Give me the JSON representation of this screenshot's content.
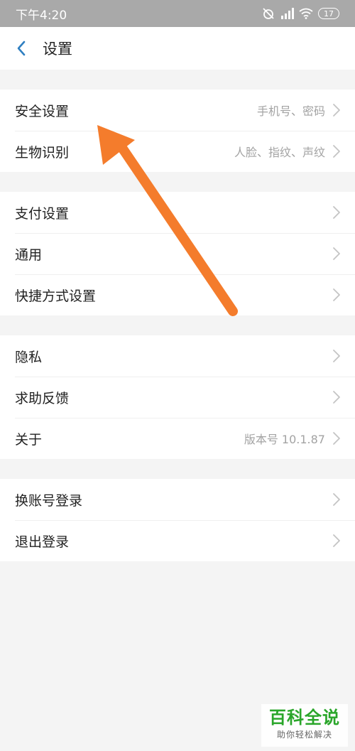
{
  "status_bar": {
    "time": "下午4:20",
    "battery": "17"
  },
  "header": {
    "title": "设置"
  },
  "groups": [
    [
      {
        "label": "安全设置",
        "value": "手机号、密码"
      },
      {
        "label": "生物识别",
        "value": "人脸、指纹、声纹"
      }
    ],
    [
      {
        "label": "支付设置",
        "value": ""
      },
      {
        "label": "通用",
        "value": ""
      },
      {
        "label": "快捷方式设置",
        "value": ""
      }
    ],
    [
      {
        "label": "隐私",
        "value": ""
      },
      {
        "label": "求助反馈",
        "value": ""
      },
      {
        "label": "关于",
        "value": "版本号 10.1.87"
      }
    ],
    [
      {
        "label": "换账号登录",
        "value": ""
      },
      {
        "label": "退出登录",
        "value": ""
      }
    ]
  ],
  "watermark": {
    "title": "百科全说",
    "subtitle": "助你轻松解决"
  },
  "colors": {
    "annotation_arrow": "#f47c2c",
    "status_bar": "#a9a9a9",
    "back_icon": "#2f7fc1"
  }
}
